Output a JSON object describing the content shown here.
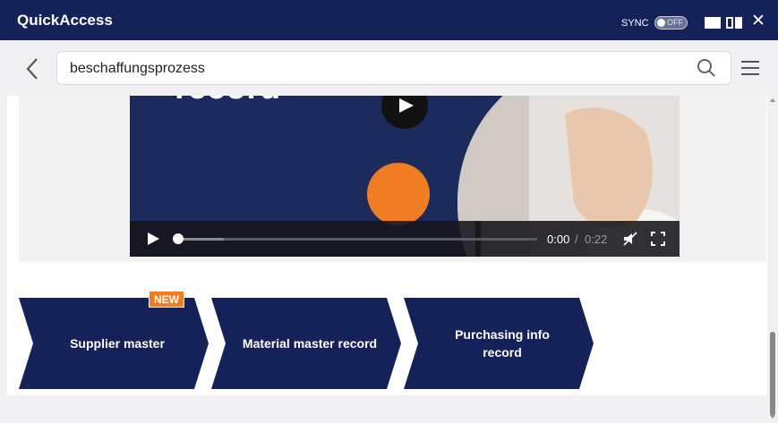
{
  "app": {
    "title": "QuickAccess",
    "sync_label": "SYNC",
    "sync_state": "OFF",
    "close_glyph": "✕"
  },
  "search": {
    "value": "beschaffungsprozess"
  },
  "video": {
    "title_fragment": "record",
    "time_current": "0:00",
    "time_separator": "/",
    "time_total": "0:22",
    "progress_percent": 0
  },
  "process_steps": [
    {
      "label": "Supplier master",
      "badge": "NEW"
    },
    {
      "label": "Material master record"
    },
    {
      "label": "Purchasing info record"
    }
  ],
  "colors": {
    "brand_navy": "#152259",
    "accent_orange": "#f07c24",
    "background": "#f1f1f3"
  },
  "icons": {
    "back": "chevron-left-icon",
    "search": "search-icon",
    "menu": "hamburger-menu-icon",
    "play": "play-icon",
    "mute": "mute-icon",
    "fullscreen": "fullscreen-icon"
  }
}
